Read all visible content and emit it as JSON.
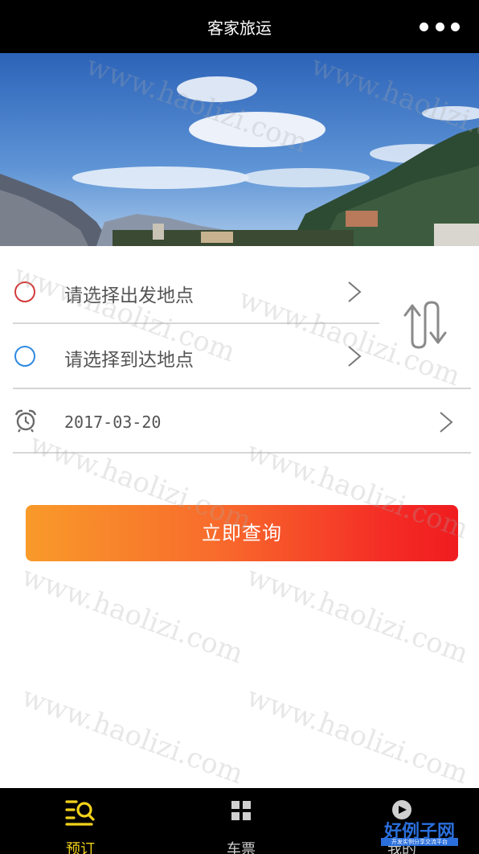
{
  "header": {
    "title": "客家旅运",
    "more_icon": "more-dots-icon"
  },
  "booking": {
    "departure_placeholder": "请选择出发地点",
    "arrival_placeholder": "请选择到达地点",
    "date": "2017-03-20",
    "query_button": "立即查询",
    "colors": {
      "departure_circle": "#d33c3c",
      "arrival_circle": "#2f8ae0",
      "button_start": "#f99a2a",
      "button_end": "#f01c1f"
    }
  },
  "watermark": {
    "text": "www.haolizi.com"
  },
  "tabbar": {
    "tabs": [
      {
        "label": "预订",
        "icon": "booking-list-icon",
        "active": true
      },
      {
        "label": "车票",
        "icon": "ticket-grid-icon",
        "active": false
      },
      {
        "label": "我的",
        "icon": "profile-icon",
        "active": false
      }
    ],
    "active_color": "#f2d21b"
  },
  "brand_watermark": {
    "title": "好例子网",
    "subtitle": "开发实例分享交流平台"
  }
}
